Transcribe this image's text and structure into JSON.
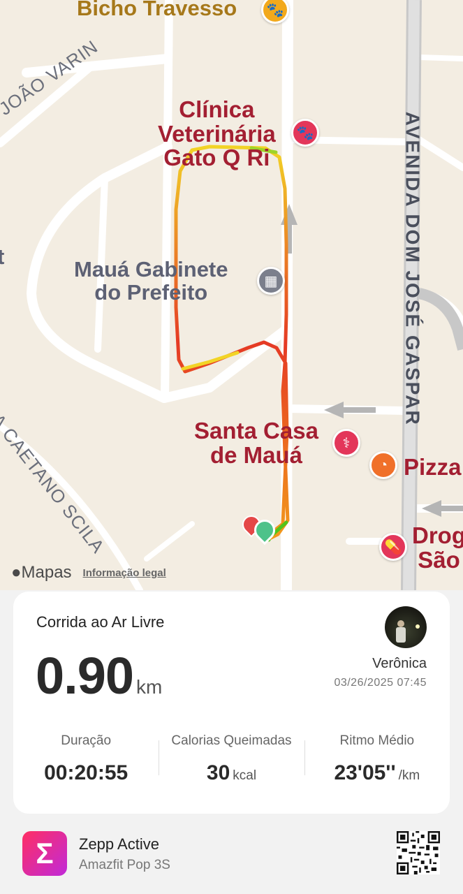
{
  "map": {
    "pois": {
      "bicho": "Bicho Travesso",
      "clinica": "Clínica\nVeterinária\nGato Q Ri",
      "gabinete": "Mauá Gabinete\ndo Prefeito",
      "santa_casa": "Santa Casa\nde Mauá",
      "pizza": "Pizza",
      "drog": "Drog\nSão"
    },
    "streets": {
      "joao_varin": "JOÃO VARIN",
      "caetano_scila": "A CAETANO SCILA",
      "dom_jose": "AVENIDA DOM JOSÉ GASPAR",
      "cut_left": "t"
    },
    "brand": "Mapas",
    "legal": "Informação legal"
  },
  "activity": {
    "type": "Corrida ao Ar Livre",
    "distance": "0.90",
    "distance_unit": "km",
    "user_name": "Verônica",
    "datetime": "03/26/2025 07:45",
    "stats": [
      {
        "label": "Duração",
        "value": "00:20:55",
        "unit": ""
      },
      {
        "label": "Calorias Queimadas",
        "value": "30",
        "unit": "kcal"
      },
      {
        "label": "Ritmo Médio",
        "value": "23'05''",
        "unit": "/km"
      }
    ]
  },
  "footer": {
    "app_icon_glyph": "Σ",
    "app_name": "Zepp Active",
    "device": "Amazfit Pop 3S"
  },
  "colors": {
    "poi_red": "#a31f32",
    "route_red": "#e53a24",
    "route_yellow": "#f2d426",
    "route_green": "#52c41a",
    "app_gradient_start": "#ff2e63",
    "app_gradient_end": "#c02ad9"
  }
}
